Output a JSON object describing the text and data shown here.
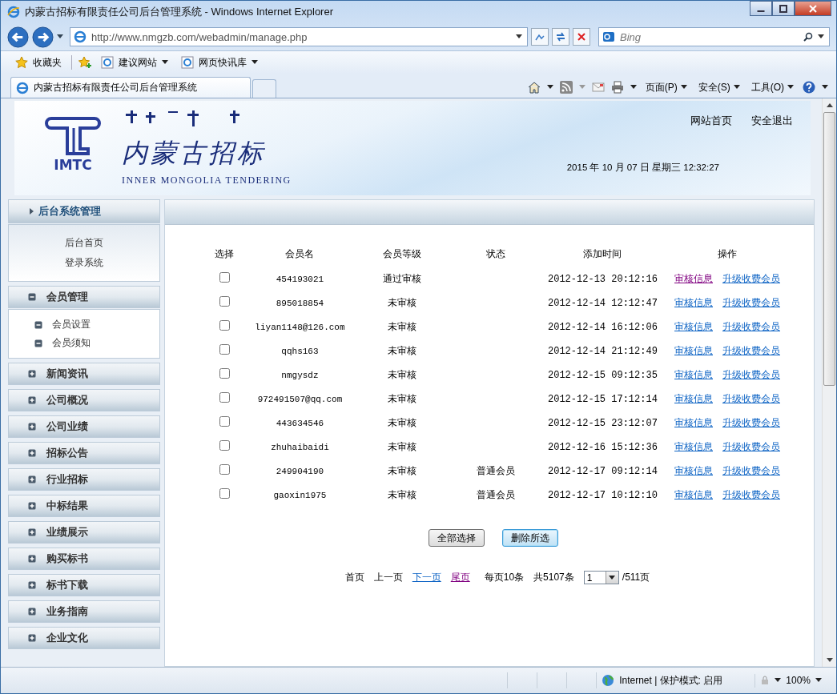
{
  "window": {
    "title": "内蒙古招标有限责任公司后台管理系统 - Windows Internet Explorer"
  },
  "address_bar": {
    "url": "http://www.nmgzb.com/webadmin/manage.php"
  },
  "search": {
    "placeholder": "Bing"
  },
  "favorites_bar": [
    {
      "label": "收藏夹",
      "kind": "favorites"
    },
    {
      "label": "建议网站",
      "kind": "menu"
    },
    {
      "label": "网页快讯库",
      "kind": "menu"
    }
  ],
  "tab": {
    "title": "内蒙古招标有限责任公司后台管理系统"
  },
  "command_bar": [
    "页面(P)",
    "安全(S)",
    "工具(O)"
  ],
  "header": {
    "logo_mark": "IMTC",
    "logo_title": "内蒙古招标",
    "logo_subtitle": "INNER MONGOLIA TENDERING",
    "links": [
      "网站首页",
      "安全退出"
    ],
    "date": "2015 年 10 月 07 日 星期三 12:32:27"
  },
  "sidebar": {
    "title": "后台系统管理",
    "links": [
      "后台首页",
      "登录系统"
    ],
    "groups": [
      {
        "label": "会员管理",
        "expanded": true,
        "children": [
          {
            "label": "会员设置"
          },
          {
            "label": "会员须知"
          }
        ]
      },
      {
        "label": "新闻资讯",
        "expanded": false
      },
      {
        "label": "公司概况",
        "expanded": false
      },
      {
        "label": "公司业绩",
        "expanded": false
      },
      {
        "label": "招标公告",
        "expanded": false
      },
      {
        "label": "行业招标",
        "expanded": false
      },
      {
        "label": "中标结果",
        "expanded": false
      },
      {
        "label": "业绩展示",
        "expanded": false
      },
      {
        "label": "购买标书",
        "expanded": false
      },
      {
        "label": "标书下载",
        "expanded": false
      },
      {
        "label": "业务指南",
        "expanded": false
      },
      {
        "label": "企业文化",
        "expanded": false
      }
    ]
  },
  "table": {
    "columns": [
      "选择",
      "会员名",
      "会员等级",
      "状态",
      "添加时间",
      "操作"
    ],
    "rows": [
      {
        "checked": false,
        "name": "454193021",
        "level": "通过审核",
        "time": "2012-12-13 20:12:16",
        "actions": [
          {
            "label": "审核信息",
            "visited": true
          },
          {
            "label": "升级收费会员",
            "visited": false
          }
        ]
      },
      {
        "checked": false,
        "name": "895018854",
        "level": "未审核",
        "time": "2012-12-14 12:12:47",
        "actions": [
          {
            "label": "审核信息",
            "visited": false
          },
          {
            "label": "升级收费会员",
            "visited": false
          }
        ]
      },
      {
        "checked": false,
        "name": "liyan1148@126.com",
        "level": "未审核",
        "time": "2012-12-14 16:12:06",
        "actions": [
          {
            "label": "审核信息",
            "visited": false
          },
          {
            "label": "升级收费会员",
            "visited": false
          }
        ]
      },
      {
        "checked": false,
        "name": "qqhs163",
        "level": "未审核",
        "time": "2012-12-14 21:12:49",
        "actions": [
          {
            "label": "审核信息",
            "visited": false
          },
          {
            "label": "升级收费会员",
            "visited": false
          }
        ]
      },
      {
        "checked": false,
        "name": "nmgysdz",
        "level": "未审核",
        "time": "2012-12-15 09:12:35",
        "actions": [
          {
            "label": "审核信息",
            "visited": false
          },
          {
            "label": "升级收费会员",
            "visited": false
          }
        ]
      },
      {
        "checked": false,
        "name": "972491507@qq.com",
        "level": "未审核",
        "time": "2012-12-15 17:12:14",
        "actions": [
          {
            "label": "审核信息",
            "visited": false
          },
          {
            "label": "升级收费会员",
            "visited": false
          }
        ]
      },
      {
        "checked": false,
        "name": "443634546",
        "level": "未审核",
        "time": "2012-12-15 23:12:07",
        "actions": [
          {
            "label": "审核信息",
            "visited": false
          },
          {
            "label": "升级收费会员",
            "visited": false
          }
        ]
      },
      {
        "checked": false,
        "name": "zhuhaibaidi",
        "level": "未审核",
        "time": "2012-12-16 15:12:36",
        "actions": [
          {
            "label": "审核信息",
            "visited": false
          },
          {
            "label": "升级收费会员",
            "visited": false
          }
        ]
      },
      {
        "checked": false,
        "name": "249904190",
        "level": "未审核",
        "status": "普通会员",
        "time": "2012-12-17 09:12:14",
        "actions": [
          {
            "label": "审核信息",
            "visited": false
          },
          {
            "label": "升级收费会员",
            "visited": false
          }
        ]
      },
      {
        "checked": false,
        "name": "gaoxin1975",
        "level": "未审核",
        "status": "普通会员",
        "time": "2012-12-17 10:12:10",
        "actions": [
          {
            "label": "审核信息",
            "visited": false
          },
          {
            "label": "升级收费会员",
            "visited": false
          }
        ]
      }
    ]
  },
  "buttons": [
    {
      "label": "全部选择",
      "focused": false
    },
    {
      "label": "删除所选",
      "focused": true
    }
  ],
  "pagination": {
    "links": [
      {
        "label": "首页",
        "kind": "text"
      },
      {
        "label": "上一页",
        "kind": "text"
      },
      {
        "label": "下一页",
        "kind": "link"
      },
      {
        "label": "尾页",
        "kind": "visited"
      }
    ],
    "per_page": "每页10条",
    "total": "共5107条",
    "page_select": "1",
    "page_count": "/511页"
  },
  "status_bar": {
    "zone": "Internet | 保护模式: 启用",
    "zoom": "100%"
  }
}
